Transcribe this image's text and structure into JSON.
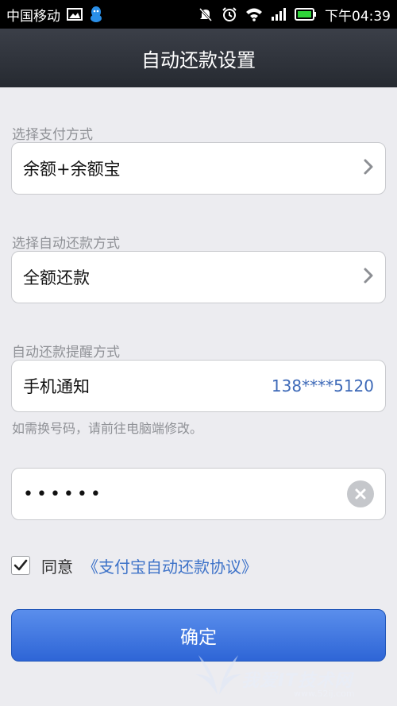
{
  "status_bar": {
    "carrier": "中国移动",
    "time": "下午04:39"
  },
  "nav": {
    "title": "自动还款设置"
  },
  "payment": {
    "label": "选择支付方式",
    "value": "余额+余额宝"
  },
  "repay_mode": {
    "label": "选择自动还款方式",
    "value": "全额还款"
  },
  "reminder": {
    "label": "自动还款提醒方式",
    "value": "手机通知",
    "phone": "138****5120",
    "hint": "如需换号码，请前往电脑端修改。"
  },
  "password": {
    "value": "••••••"
  },
  "agreement": {
    "checked": true,
    "agree_text": "同意",
    "link_text": "《支付宝自动还款协议》"
  },
  "confirm": {
    "label": "确定"
  },
  "watermark": {
    "text": "我爱IT技术网",
    "url": "www.52ij.com"
  },
  "colors": {
    "nav_bg": "#2b2f36",
    "accent_blue": "#3d72c8",
    "button_blue": "#3a70e0",
    "background": "#ececf0"
  },
  "icons": {
    "status": [
      "gallery-icon",
      "qq-icon",
      "mute-icon",
      "alarm-icon",
      "wifi-icon",
      "signal-icon",
      "battery-icon"
    ],
    "chevron": "chevron-right-icon",
    "clear": "clear-icon",
    "check": "check-icon"
  }
}
